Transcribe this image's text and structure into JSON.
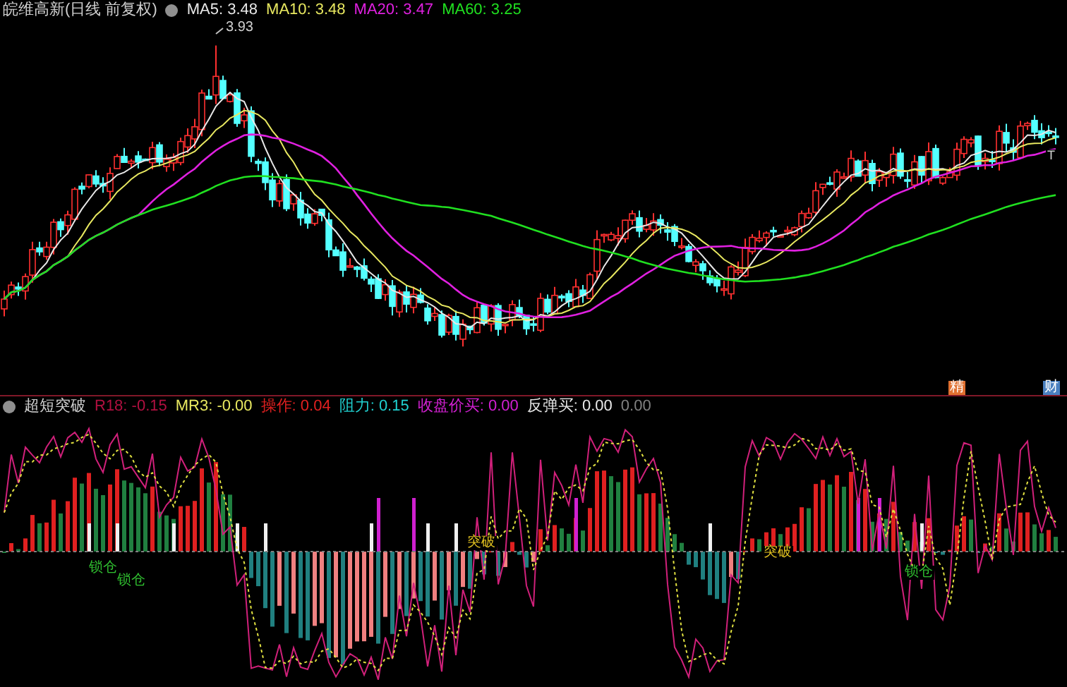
{
  "main_header": {
    "title": "皖维高新(日线 前复权)",
    "indicators": [
      {
        "label": "MA5: 3.48",
        "color": "#e8e8e8"
      },
      {
        "label": "MA10: 3.48",
        "color": "#e8e860"
      },
      {
        "label": "MA20: 3.47",
        "color": "#e020e0"
      },
      {
        "label": "MA60: 3.25",
        "color": "#20e020"
      }
    ]
  },
  "main_chart": {
    "high_label": "3.93",
    "marker": "T",
    "badges": [
      {
        "text": "精",
        "color": "#e07030"
      },
      {
        "text": "财",
        "color": "#4a80c0"
      }
    ]
  },
  "sub_header": {
    "title": "超短突破",
    "indicators": [
      {
        "label": "R18: -0.15",
        "color": "#b01040"
      },
      {
        "label": "MR3: -0.00",
        "color": "#e8e860"
      },
      {
        "label": "操作: 0.04",
        "color": "#e02020"
      },
      {
        "label": "阻力: 0.15",
        "color": "#20d0d0"
      },
      {
        "label": "收盘价买: 0.00",
        "color": "#d020d0"
      },
      {
        "label": "反弹买: 0.00",
        "color": "#e8e8e8"
      },
      {
        "label": "0.00",
        "color": "#808080"
      }
    ]
  },
  "sub_chart": {
    "signals": [
      {
        "text": "锁仓",
        "kind": "lock"
      },
      {
        "text": "锁仓",
        "kind": "lock"
      },
      {
        "text": "突破",
        "kind": "break"
      },
      {
        "text": "突破",
        "kind": "break"
      },
      {
        "text": "锁仓",
        "kind": "lock"
      }
    ]
  }
}
